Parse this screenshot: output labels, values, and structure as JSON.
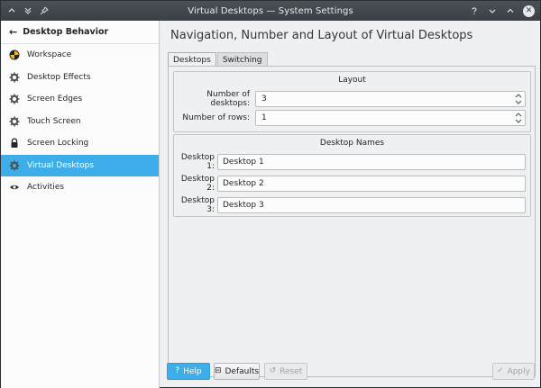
{
  "window": {
    "title": "Virtual Desktops — System Settings",
    "icons": [
      "collapse-icon",
      "keep-below-icon",
      "pin-icon",
      "help-icon",
      "minimize-icon",
      "maximize-icon",
      "close-icon"
    ],
    "close_glyph": "✕"
  },
  "sidebar": {
    "header": "Desktop Behavior",
    "back_glyph": "←",
    "items": [
      {
        "label": "Workspace",
        "icon": "workspace-icon"
      },
      {
        "label": "Desktop Effects",
        "icon": "gear-icon"
      },
      {
        "label": "Screen Edges",
        "icon": "gear-icon"
      },
      {
        "label": "Touch Screen",
        "icon": "gear-icon"
      },
      {
        "label": "Screen Locking",
        "icon": "lock-icon"
      },
      {
        "label": "Virtual Desktops",
        "icon": "gear-icon",
        "active": true
      },
      {
        "label": "Activities",
        "icon": "activities-icon"
      }
    ]
  },
  "main": {
    "title": "Navigation, Number and Layout of Virtual Desktops",
    "tabs": [
      {
        "label": "Desktops",
        "active": true
      },
      {
        "label": "Switching",
        "active": false
      }
    ],
    "layout_group": {
      "title": "Layout",
      "number_of_desktops_label": "Number of desktops:",
      "number_of_desktops_value": "3",
      "number_of_rows_label": "Number of rows:",
      "number_of_rows_value": "1"
    },
    "names_group": {
      "title": "Desktop Names",
      "desktops": [
        {
          "label": "Desktop 1:",
          "value": "Desktop 1"
        },
        {
          "label": "Desktop 2:",
          "value": "Desktop 2"
        },
        {
          "label": "Desktop 3:",
          "value": "Desktop 3"
        }
      ]
    }
  },
  "buttons": {
    "help": {
      "label": "Help",
      "glyph": "?"
    },
    "defaults": {
      "label": "Defaults",
      "glyph": "⊟"
    },
    "reset": {
      "label": "Reset",
      "glyph": "↺"
    },
    "apply": {
      "label": "Apply",
      "glyph": "✓"
    }
  },
  "colors": {
    "accent": "#3daee9",
    "titlebar": "#3b4045",
    "window_bg": "#eff0f1"
  }
}
